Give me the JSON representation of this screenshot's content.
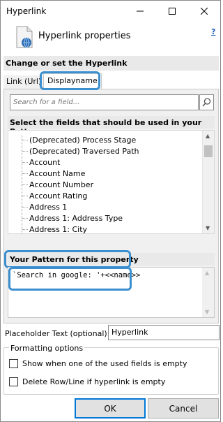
{
  "window": {
    "title": "Hyperlink",
    "controls": [
      "minimize-icon",
      "maximize-icon",
      "close-icon"
    ]
  },
  "header": {
    "title": "Hyperlink properties",
    "icon": "document-link-icon",
    "help": "?"
  },
  "section": {
    "title": "Change or set the Hyperlink"
  },
  "tabs": [
    {
      "label": "Link (Url)",
      "active": false
    },
    {
      "label": "Displayname",
      "active": true
    }
  ],
  "search": {
    "placeholder": "Search for a field...",
    "icon": "search-icon"
  },
  "fields": {
    "title": "Select the fields that should be used in your Pattern",
    "items": [
      "(Deprecated) Process Stage",
      "(Deprecated) Traversed Path",
      "Account",
      "Account Name",
      "Account Number",
      "Account Rating",
      "Address 1",
      "Address 1: Address Type",
      "Address 1: City"
    ]
  },
  "pattern": {
    "title": "Your Pattern for this property",
    "value": "`Search in google: '+<<name>>"
  },
  "placeholder": {
    "label": "Placeholder Text (optional):",
    "value": "Hyperlink"
  },
  "formatting": {
    "title": "Formatting options",
    "options": [
      {
        "label": "Show when one of the used fields is empty",
        "checked": false
      },
      {
        "label": "Delete Row/Line if hyperlink is empty",
        "checked": false
      }
    ]
  },
  "buttons": {
    "ok": "OK",
    "cancel": "Cancel"
  },
  "colors": {
    "highlight": "#3b8fcf",
    "section_bg": "#e9e9e9",
    "panel_bg": "#f0f0f0"
  }
}
